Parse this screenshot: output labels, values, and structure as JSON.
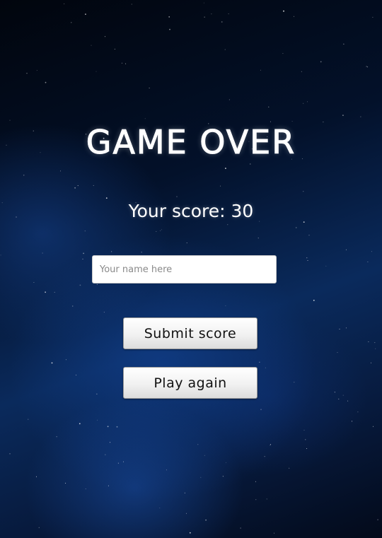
{
  "screen": {
    "title": "GAME OVER",
    "score_text": "Your score: 30"
  },
  "name_input": {
    "value": "",
    "placeholder": "Your name here"
  },
  "buttons": {
    "submit_label": "Submit score",
    "play_again_label": "Play again"
  },
  "colors": {
    "text": "#ffffff",
    "background_deep": "#01050d",
    "background_nebula": "#0a2a5c",
    "button_face": "#f1f1f1"
  }
}
